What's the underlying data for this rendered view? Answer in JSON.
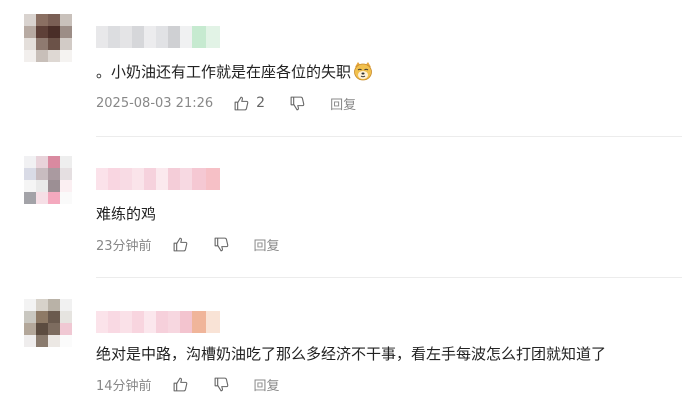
{
  "comments": [
    {
      "text": "。小奶油还有工作就是在座各位的失职",
      "emoji_icon": "doge-face-icon",
      "time": "2025-08-03 21:26",
      "likes": "2",
      "reply_label": "回复",
      "avatar_colors": [
        "#d9d3cf",
        "#8a6f62",
        "#7a5f55",
        "#c9c1bb",
        "#b7aaa2",
        "#5e4038",
        "#4a2e28",
        "#9c8d86",
        "#e4dfdb",
        "#8f7a70",
        "#6b5248",
        "#d2cbc6",
        "#f2efed",
        "#c8bfb9",
        "#ded8d3",
        "#f5f3f1"
      ],
      "nickname_colors": [
        "#e8e8ea",
        "#dcdde0",
        "#e4e4e6",
        "#d6d7da",
        "#ececee",
        "#e1e2e5",
        "#cfd0d3",
        "#f0f1f2",
        "#c6ead0",
        "#e2f3e6"
      ]
    },
    {
      "text": "难练的鸡",
      "time": "23分钟前",
      "likes": "",
      "reply_label": "回复",
      "avatar_colors": [
        "#f1f1f3",
        "#e8d3da",
        "#d98aa0",
        "#eeeeee",
        "#d9dbe6",
        "#c8bcc0",
        "#aa9aa0",
        "#e5dfe1",
        "#f5f5f5",
        "#eaeaea",
        "#9c8f94",
        "#fbeff2",
        "#a3a3a8",
        "#f6dfe6",
        "#f4a9be",
        "#fafafa"
      ],
      "nickname_colors": [
        "#fbe2ea",
        "#f9d6e1",
        "#f8dbe4",
        "#fae4ea",
        "#f6d2dd",
        "#fbe9ee",
        "#f4cdd8",
        "#f7d9e2",
        "#f5c8d3",
        "#f6c0c6"
      ]
    },
    {
      "text": "绝对是中路，沟槽奶油吃了那么多经济不干事，看左手每波怎么打团就知道了",
      "time": "14分钟前",
      "likes": "",
      "reply_label": "回复",
      "avatar_colors": [
        "#f3f3f3",
        "#d7d2ca",
        "#b9b2a7",
        "#f1f1f1",
        "#c9c7c0",
        "#8e7a66",
        "#6a5a4e",
        "#e6e4e0",
        "#b3a79a",
        "#5c4c40",
        "#7d6c5f",
        "#f0c8d3",
        "#efeded",
        "#8a7b6e",
        "#ece8e4",
        "#fbfbfb"
      ],
      "nickname_colors": [
        "#fbe3ea",
        "#f9d9e3",
        "#fae1e8",
        "#f8d5df",
        "#fbe7ed",
        "#f6d0db",
        "#f7d7e0",
        "#f3c4cf",
        "#f0b59a",
        "#f9e3d6"
      ]
    }
  ]
}
